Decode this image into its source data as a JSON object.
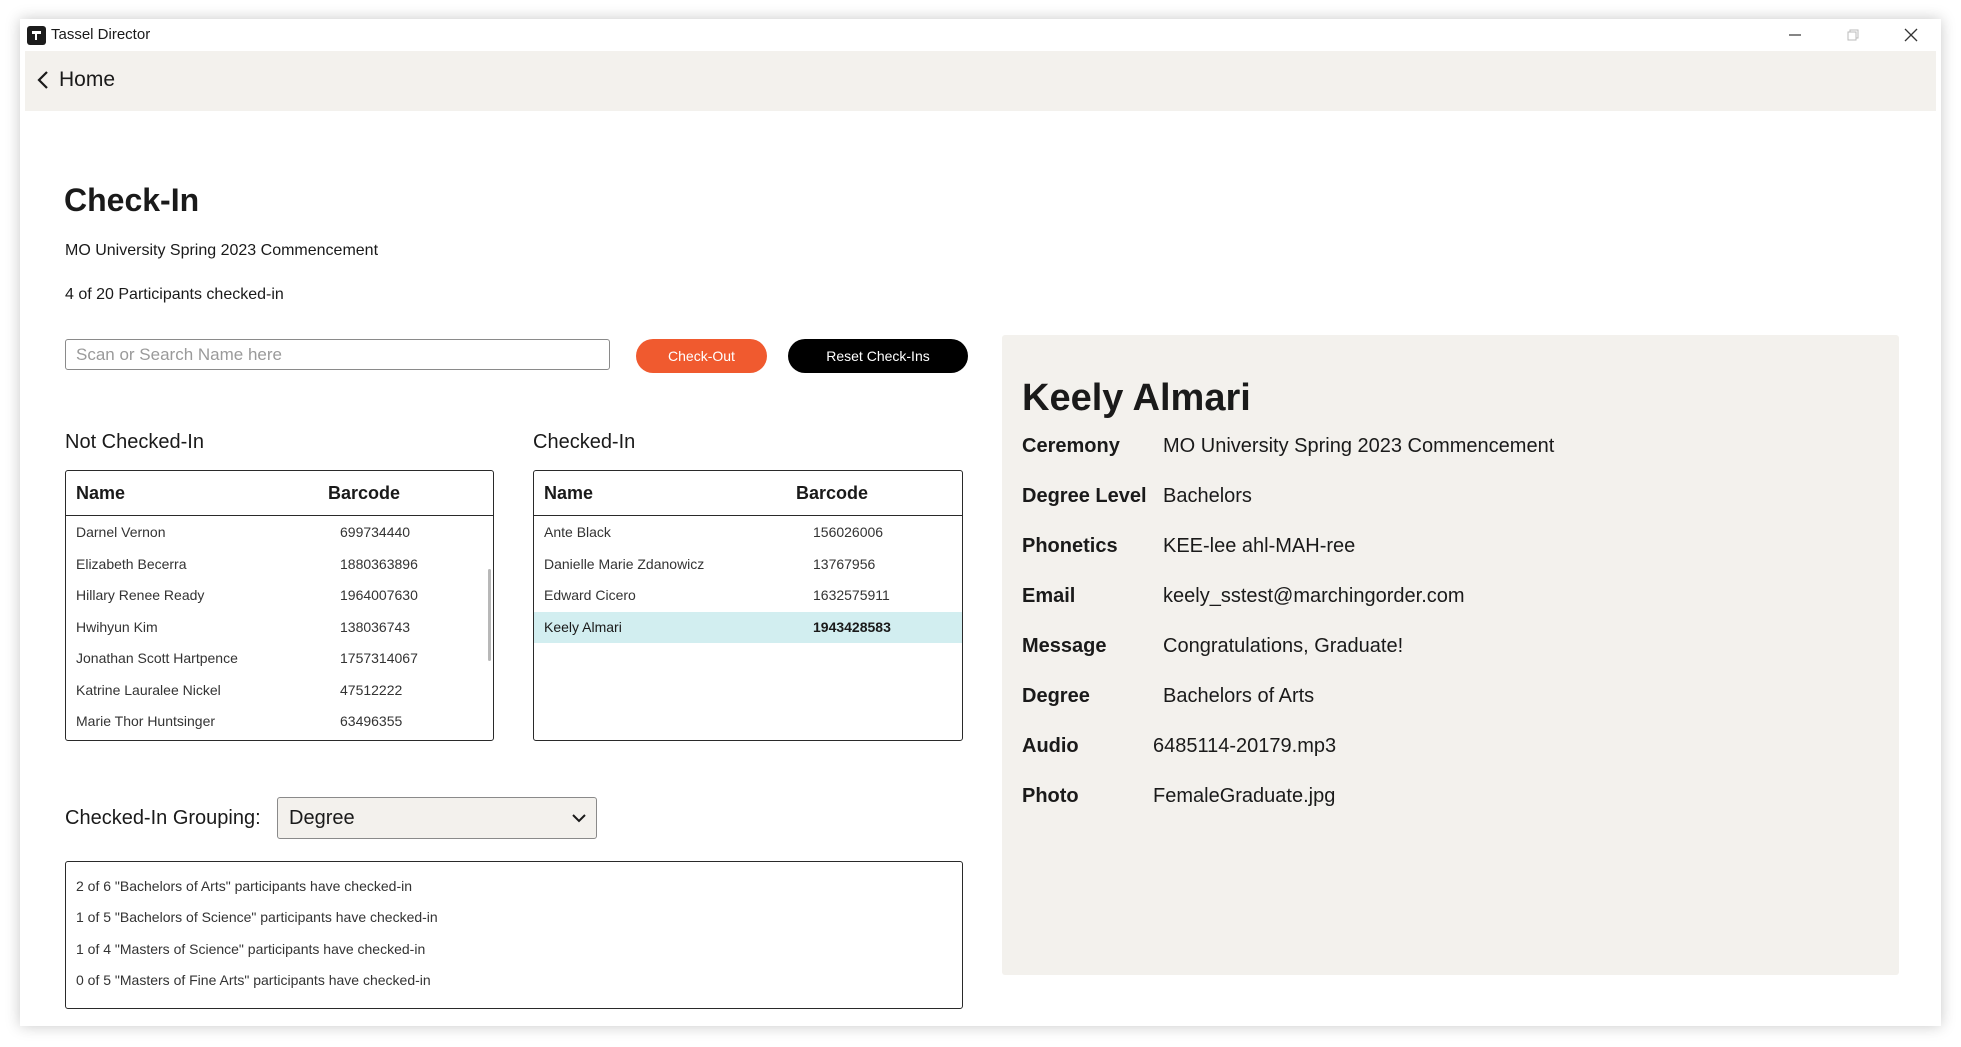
{
  "window": {
    "title": "Tassel Director"
  },
  "header": {
    "back_label": "Home"
  },
  "page": {
    "title": "Check-In",
    "event_name": "MO University Spring 2023 Commencement",
    "count_text": "4 of 20 Participants checked-in"
  },
  "search": {
    "placeholder": "Scan or Search Name here",
    "value": ""
  },
  "buttons": {
    "checkout_label": "Check-Out",
    "reset_label": "Reset Check-Ins"
  },
  "not_checked_in": {
    "label": "Not Checked-In",
    "columns": [
      "Name",
      "Barcode"
    ],
    "rows": [
      {
        "name": "Darnel Vernon",
        "barcode": "699734440"
      },
      {
        "name": "Elizabeth Becerra",
        "barcode": "1880363896"
      },
      {
        "name": "Hillary Renee Ready",
        "barcode": "1964007630"
      },
      {
        "name": "Hwihyun Kim",
        "barcode": "138036743"
      },
      {
        "name": "Jonathan Scott Hartpence",
        "barcode": "1757314067"
      },
      {
        "name": "Katrine Lauralee Nickel",
        "barcode": "47512222"
      },
      {
        "name": "Marie Thor Huntsinger",
        "barcode": "63496355"
      }
    ]
  },
  "checked_in": {
    "label": "Checked-In",
    "columns": [
      "Name",
      "Barcode"
    ],
    "rows": [
      {
        "name": "Ante Black",
        "barcode": "156026006"
      },
      {
        "name": "Danielle Marie Zdanowicz",
        "barcode": "13767956"
      },
      {
        "name": "Edward Cicero",
        "barcode": "1632575911"
      },
      {
        "name": "Keely Almari",
        "barcode": "1943428583"
      }
    ],
    "selected_index": 3
  },
  "grouping": {
    "label": "Checked-In Grouping:",
    "selected": "Degree",
    "summary": [
      "2 of 6 \"Bachelors of Arts\" participants have checked-in",
      "1 of 5 \"Bachelors of Science\" participants have checked-in",
      "1 of 4 \"Masters of Science\" participants have checked-in",
      "0 of 5 \"Masters of Fine Arts\" participants have checked-in"
    ]
  },
  "details": {
    "name": "Keely Almari",
    "fields": [
      {
        "key": "Ceremony",
        "value": "MO University Spring 2023 Commencement"
      },
      {
        "key": "Degree Level",
        "value": "Bachelors"
      },
      {
        "key": "Phonetics",
        "value": "KEE-lee ahl-MAH-ree"
      },
      {
        "key": "Email",
        "value": "keely_sstest@marchingorder.com"
      },
      {
        "key": "Message",
        "value": "Congratulations, Graduate!"
      },
      {
        "key": "Degree",
        "value": "Bachelors of Arts"
      },
      {
        "key": "Audio",
        "value": "6485114-20179.mp3"
      },
      {
        "key": "Photo",
        "value": "FemaleGraduate.jpg"
      }
    ]
  },
  "colors": {
    "accent_orange": "#f05a2f",
    "panel_bg": "#f3f1ed",
    "selected_row": "#d2eef0"
  }
}
